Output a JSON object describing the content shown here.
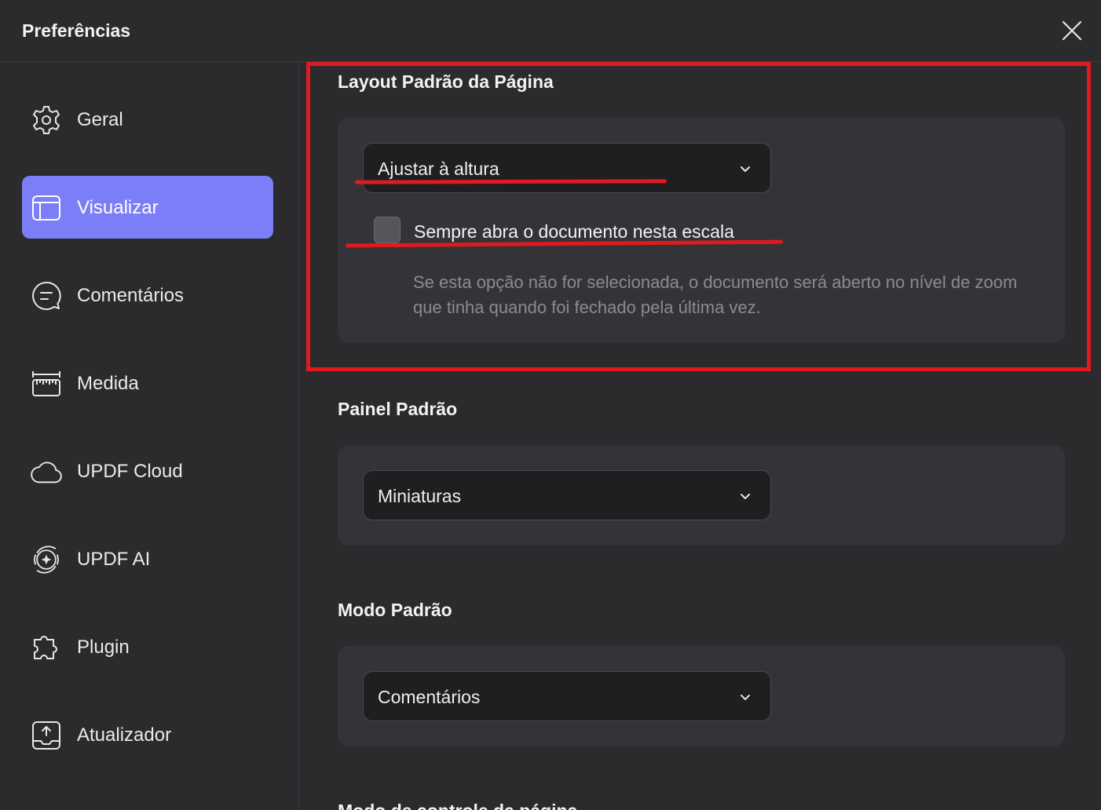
{
  "window": {
    "title": "Preferências"
  },
  "sidebar": {
    "items": [
      {
        "label": "Geral",
        "icon": "gear-icon",
        "active": false
      },
      {
        "label": "Visualizar",
        "icon": "layout-icon",
        "active": true
      },
      {
        "label": "Comentários",
        "icon": "comment-icon",
        "active": false
      },
      {
        "label": "Medida",
        "icon": "ruler-icon",
        "active": false
      },
      {
        "label": "UPDF Cloud",
        "icon": "cloud-icon",
        "active": false
      },
      {
        "label": "UPDF AI",
        "icon": "ai-sparkle-icon",
        "active": false
      },
      {
        "label": "Plugin",
        "icon": "puzzle-icon",
        "active": false
      },
      {
        "label": "Atualizador",
        "icon": "update-icon",
        "active": false
      }
    ]
  },
  "main": {
    "layout": {
      "title": "Layout Padrão da Página",
      "select_value": "Ajustar à altura",
      "checkbox_label": "Sempre abra o documento nesta escala",
      "checkbox_checked": false,
      "helper": "Se esta opção não for selecionada, o documento será aberto no nível de zoom que tinha quando foi fechado pela última vez."
    },
    "panel": {
      "title": "Painel Padrão",
      "select_value": "Miniaturas"
    },
    "mode": {
      "title": "Modo Padrão",
      "select_value": "Comentários"
    },
    "page_control": {
      "title": "Modo de controle da página"
    }
  },
  "colors": {
    "background": "#2b2b2e",
    "card": "#343438",
    "accent": "#7b7ef6",
    "annotation": "#e01a1e"
  }
}
